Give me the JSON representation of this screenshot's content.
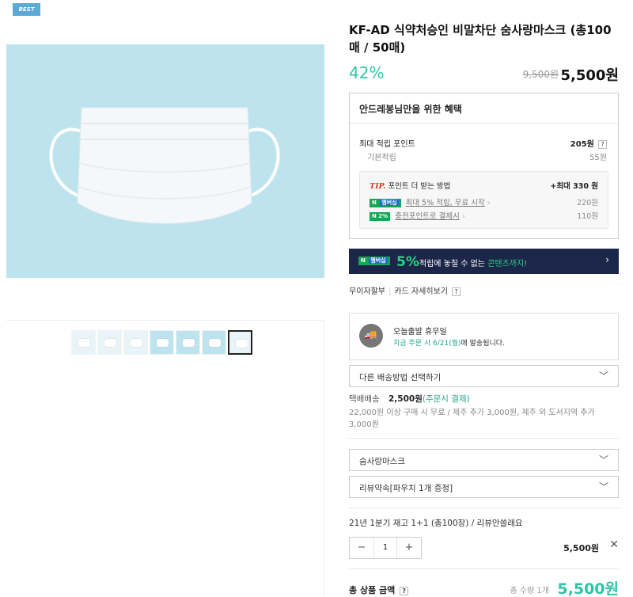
{
  "gallery": {
    "badge": "BEST",
    "thumbnails": 7,
    "active_thumbnail": 7
  },
  "product": {
    "title": "KF-AD 식약처승인 비말차단 숨사랑마스크 (총100 매 / 50매)",
    "discount": "42%",
    "original_price": "9,500원",
    "sale_price": "5,500원"
  },
  "benefits": {
    "heading": "안드레봉님만을 위한 혜택",
    "max_points_label": "최대 적립 포인트",
    "max_points_value": "205원",
    "help_mark": "?",
    "base_points_label": "기본적립",
    "base_points_value": "55원",
    "tip_label": "TIP.",
    "tip_title": "포인트 더 받는 방법",
    "tip_max": "+최대 330 원",
    "npay_label": "N",
    "membership_label": "멤버십",
    "npay_percent_label": "2%",
    "tip_items": [
      {
        "text": "최대 5% 적립, 무료 시작",
        "value": "220원"
      },
      {
        "text": "충전포인트로 결제시",
        "value": "110원"
      }
    ]
  },
  "banner": {
    "percent": "5%",
    "text_mid": "적립에 놓칠 수 없는 ",
    "highlight": "콘텐츠까지!",
    "arrow": "›"
  },
  "installment": {
    "label": "무이자할부",
    "card_link": "카드 자세히보기"
  },
  "shipping": {
    "title": "오늘출발 휴무일",
    "sub_teal": "지금 주문 시 6/21(월)",
    "sub_rest": "에 발송됩니다.",
    "method_select": "다른 배송방법 선택하기",
    "delivery_label": "택배배송",
    "delivery_fee": "2,500원",
    "delivery_pay": "(주문시 결제)",
    "note": "22,000원 이상 구매 시 무료 / 제주 추가 3,000원, 제주 외 도서지역 추가 3,000원"
  },
  "options": {
    "select1": "숨사랑마스크",
    "select2": "리뷰약속[파우치 1개 증정]",
    "chosen": "21년 1분기 재고 1+1 (총100장) / 리뷰안쓸래요",
    "quantity": "1",
    "minus": "−",
    "plus": "+",
    "line_price": "5,500원",
    "remove": "✕"
  },
  "total": {
    "label": "총 상품 금액",
    "count": "총 수량 1개",
    "amount": "5,500원"
  },
  "colors": {
    "accent": "#2ec4a6",
    "banner_bg": "#1c2649",
    "npay_green": "#19a556"
  }
}
